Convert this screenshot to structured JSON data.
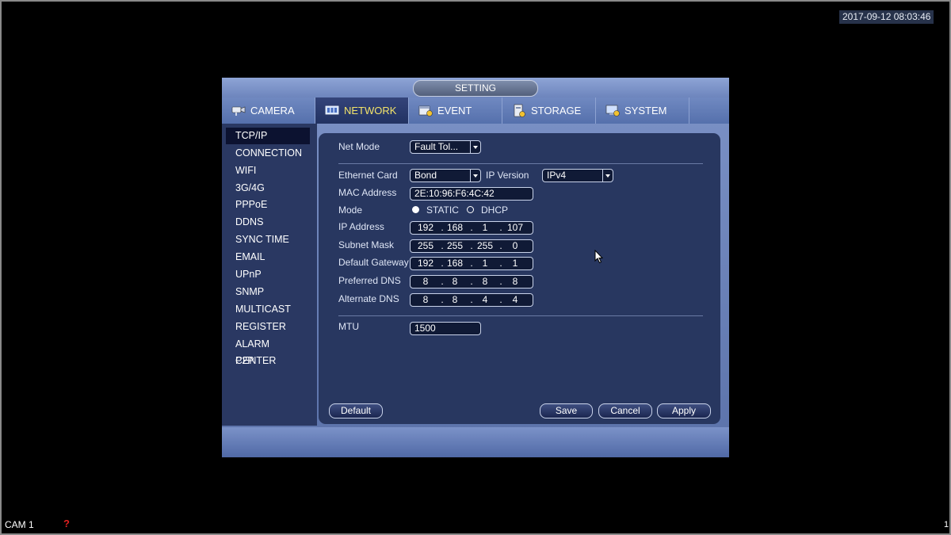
{
  "datetime": "2017-09-12 08:03:46",
  "camera_label": "CAM 1",
  "channel_number": "1",
  "window_title": "SETTING",
  "tabs": [
    {
      "label": "CAMERA",
      "icon": "camera-icon"
    },
    {
      "label": "NETWORK",
      "icon": "network-icon"
    },
    {
      "label": "EVENT",
      "icon": "event-icon"
    },
    {
      "label": "STORAGE",
      "icon": "storage-icon"
    },
    {
      "label": "SYSTEM",
      "icon": "system-icon"
    }
  ],
  "active_tab": "NETWORK",
  "sidebar": {
    "active": "TCP/IP",
    "items": [
      {
        "label": "TCP/IP"
      },
      {
        "label": "CONNECTION"
      },
      {
        "label": "WIFI"
      },
      {
        "label": "3G/4G"
      },
      {
        "label": "PPPoE"
      },
      {
        "label": "DDNS"
      },
      {
        "label": "SYNC TIME"
      },
      {
        "label": "EMAIL"
      },
      {
        "label": "UPnP"
      },
      {
        "label": "SNMP"
      },
      {
        "label": "MULTICAST"
      },
      {
        "label": "REGISTER"
      },
      {
        "label": "ALARM CENTER"
      },
      {
        "label": "P2P"
      }
    ]
  },
  "form": {
    "net_mode": {
      "label": "Net Mode",
      "value": "Fault Tol..."
    },
    "ethernet_card": {
      "label": "Ethernet Card",
      "value": "Bond"
    },
    "ip_version": {
      "label": "IP Version",
      "value": "IPv4"
    },
    "mac_address": {
      "label": "MAC Address",
      "value": "2E:10:96:F6:4C:42"
    },
    "mode": {
      "label": "Mode",
      "options": [
        "STATIC",
        "DHCP"
      ],
      "selected": "STATIC"
    },
    "ip_address": {
      "label": "IP Address",
      "octets": [
        "192",
        "168",
        "1",
        "107"
      ]
    },
    "subnet_mask": {
      "label": "Subnet Mask",
      "octets": [
        "255",
        "255",
        "255",
        "0"
      ]
    },
    "default_gateway": {
      "label": "Default Gateway",
      "octets": [
        "192",
        "168",
        "1",
        "1"
      ]
    },
    "preferred_dns": {
      "label": "Preferred DNS",
      "octets": [
        "8",
        "8",
        "8",
        "8"
      ]
    },
    "alternate_dns": {
      "label": "Alternate DNS",
      "octets": [
        "8",
        "8",
        "4",
        "4"
      ]
    },
    "mtu": {
      "label": "MTU",
      "value": "1500"
    },
    "dot": "."
  },
  "buttons": {
    "default": "Default",
    "save": "Save",
    "cancel": "Cancel",
    "apply": "Apply"
  },
  "colors": {
    "active_tab_text": "#f3e36a",
    "panel_bg": "#283760",
    "sidebar_bg": "#2a3862",
    "window_gradient_top": "#7d93c7"
  }
}
